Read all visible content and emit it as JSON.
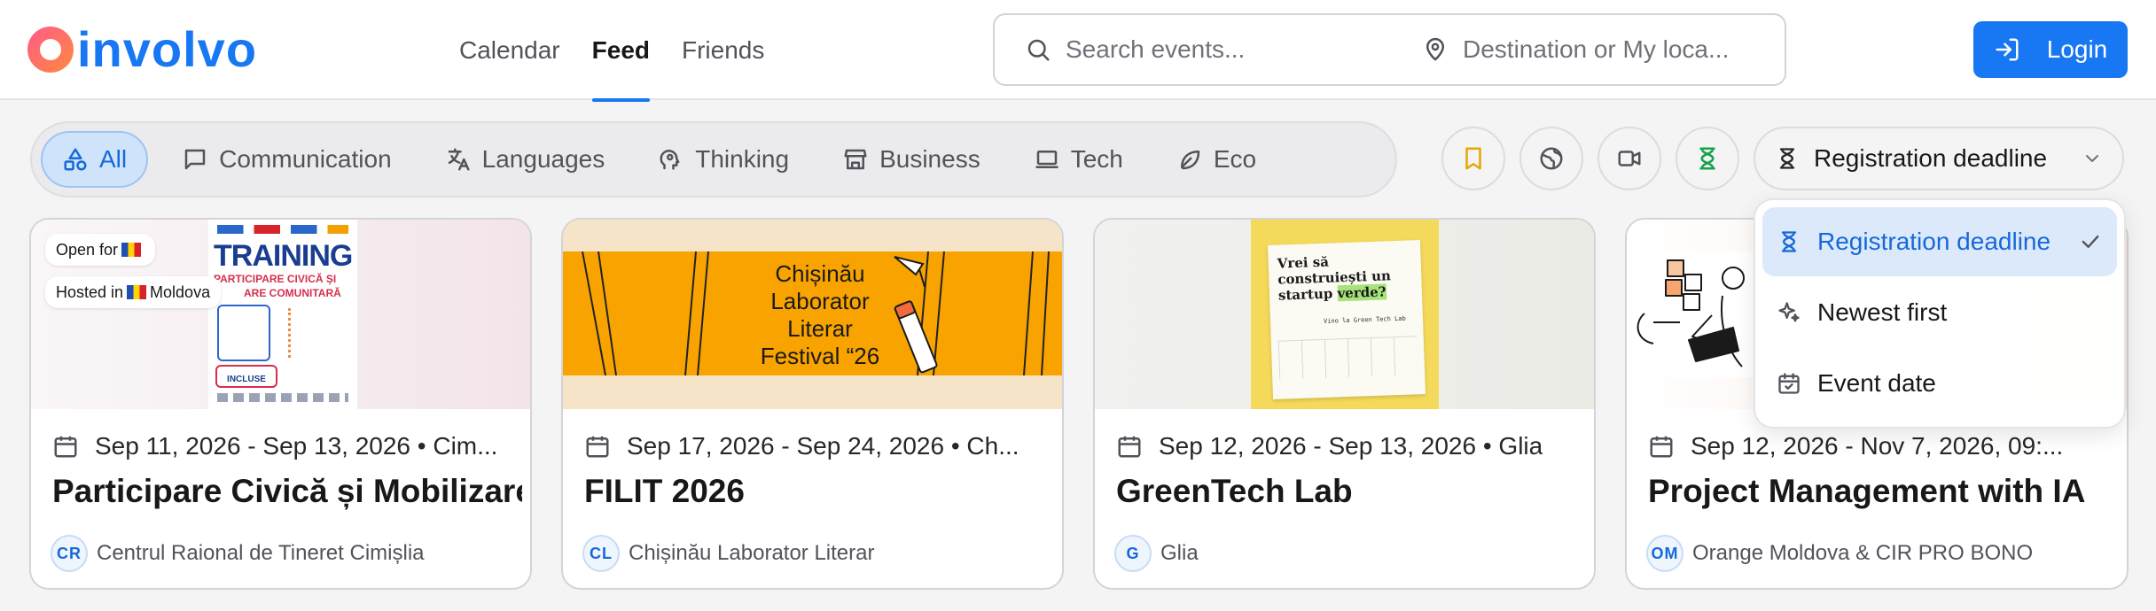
{
  "header": {
    "logo_text": "involvo",
    "nav": [
      {
        "label": "Calendar",
        "active": false
      },
      {
        "label": "Feed",
        "active": true
      },
      {
        "label": "Friends",
        "active": false
      }
    ],
    "search": {
      "events_placeholder": "Search events...",
      "location_placeholder": "Destination or My loca..."
    },
    "login_label": "Login"
  },
  "filters": {
    "categories": [
      {
        "label": "All",
        "icon": "shapes-icon",
        "active": true
      },
      {
        "label": "Communication",
        "icon": "message-square-icon",
        "active": false
      },
      {
        "label": "Languages",
        "icon": "translate-icon",
        "active": false
      },
      {
        "label": "Thinking",
        "icon": "brain-head-icon",
        "active": false
      },
      {
        "label": "Business",
        "icon": "store-icon",
        "active": false
      },
      {
        "label": "Tech",
        "icon": "laptop-icon",
        "active": false
      },
      {
        "label": "Eco",
        "icon": "leaf-icon",
        "active": false
      }
    ],
    "icon_buttons": [
      "bookmark-icon",
      "globe-icon",
      "video-icon",
      "hourglass-icon"
    ],
    "sort": {
      "selected": "Registration deadline",
      "options": [
        {
          "label": "Registration deadline",
          "icon": "hourglass-icon",
          "selected": true
        },
        {
          "label": "Newest first",
          "icon": "sparkles-icon",
          "selected": false
        },
        {
          "label": "Event date",
          "icon": "calendar-check-icon",
          "selected": false
        }
      ]
    }
  },
  "colors": {
    "brand": "#1877f2",
    "accent_gradient_start": "#ff5a8a",
    "accent_gradient_end": "#ff8a3d",
    "bookmark": "#e6a700",
    "hourglass": "#16a34a"
  },
  "cards": [
    {
      "badges": {
        "open_for": "Open for",
        "hosted_in": "Hosted in",
        "country": "Moldova"
      },
      "poster": {
        "headline": "TRAINING",
        "line1": "PARTICIPARE CIVICĂ ȘI",
        "line2": "ARE COMUNITARĂ",
        "note": "INCLUSE"
      },
      "date": "Sep 11, 2026 - Sep 13, 2026 • Cim...",
      "title": "Participare Civică și Mobilizare",
      "org_initials": "CR",
      "org_name": "Centrul Raional de Tineret Cimișlia"
    },
    {
      "poster": {
        "line1": "Chișinău",
        "line2": "Laborator",
        "line3": "Literar",
        "line4": "Festival “26"
      },
      "date": "Sep 17, 2026 - Sep 24, 2026 • Ch...",
      "title": "FILIT 2026",
      "org_initials": "CL",
      "org_name": "Chișinău Laborator Literar"
    },
    {
      "poster": {
        "line1": "Vrei să",
        "line2": "construiești un",
        "line3": "startup",
        "highlight": "verde?",
        "small": "Vino la Green Tech Lab"
      },
      "date": "Sep 12, 2026 - Sep 13, 2026 • Glia",
      "title": "GreenTech Lab",
      "org_initials": "G",
      "org_name": "Glia"
    },
    {
      "date": "Sep 12, 2026 - Nov 7, 2026, 09:...",
      "title": "Project Management with IA",
      "org_initials": "OM",
      "org_name": "Orange Moldova & CIR PRO BONO"
    }
  ]
}
